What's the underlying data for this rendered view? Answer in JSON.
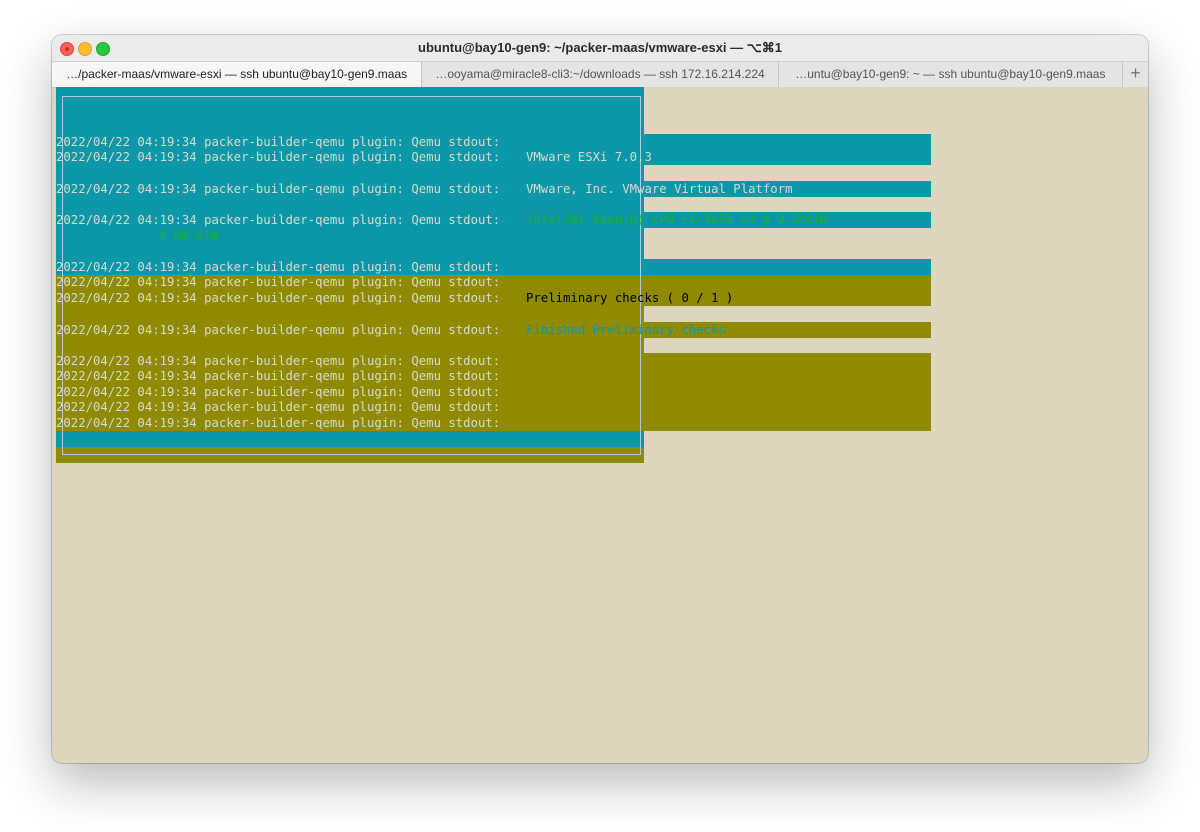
{
  "window": {
    "title": "ubuntu@bay10-gen9: ~/packer-maas/vmware-esxi — ⌥⌘1"
  },
  "tabs": [
    {
      "label": "…/packer-maas/vmware-esxi — ssh ubuntu@bay10-gen9.maas",
      "active": true
    },
    {
      "label": "…ooyama@miracle8-cli3:~/downloads — ssh 172.16.214.224",
      "active": false
    },
    {
      "label": "…untu@bay10-gen9: ~ — ssh ubuntu@bay10-gen9.maas",
      "active": false
    }
  ],
  "new_tab_label": "+",
  "terminal": {
    "log_prefix": "2022/04/22 04:19:34 packer-builder-qemu plugin: Qemu stdout:",
    "esxi_version": "VMware ESXi 7.0.3",
    "vendor_platform": "VMware, Inc. VMware Virtual Platform",
    "cpu": "Intel(R) Xeon(R) CPU E5-2650 v3 @ 2.30GHz",
    "memory": "4.00 GiB",
    "checks_progress": "Preliminary checks ( 0 / 1 )",
    "checks_finished": "Finished Preliminary checks"
  },
  "colors": {
    "dialog_teal": "#0c97a8",
    "dialog_olive": "#8f8a00",
    "terminal_bg": "#dcd6bf",
    "text_gray": "#d8dacd",
    "text_green": "#1fb317",
    "text_black": "#000000"
  }
}
